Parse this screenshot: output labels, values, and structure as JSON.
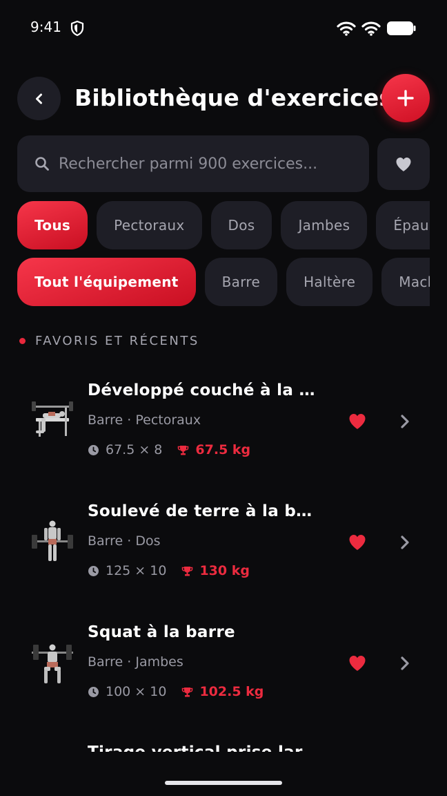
{
  "status_bar": {
    "time": "9:41"
  },
  "header": {
    "title": "Bibliothèque d'exercices"
  },
  "search": {
    "placeholder": "Rechercher parmi 900 exercices..."
  },
  "muscle_filters": [
    {
      "label": "Tous",
      "active": true
    },
    {
      "label": "Pectoraux",
      "active": false
    },
    {
      "label": "Dos",
      "active": false
    },
    {
      "label": "Jambes",
      "active": false
    },
    {
      "label": "Épaules",
      "active": false
    }
  ],
  "equipment_filters": [
    {
      "label": "Tout l'équipement",
      "active": true
    },
    {
      "label": "Barre",
      "active": false
    },
    {
      "label": "Haltère",
      "active": false
    },
    {
      "label": "Machine",
      "active": false
    }
  ],
  "section": {
    "title": "FAVORIS ET RÉCENTS"
  },
  "exercises": [
    {
      "name": "Développé couché à la barre",
      "meta": "Barre · Pectoraux",
      "last": "67.5 × 8",
      "pr": "67.5 kg",
      "favorite": true
    },
    {
      "name": "Soulevé de terre à la barre",
      "meta": "Barre · Dos",
      "last": "125 × 10",
      "pr": "130 kg",
      "favorite": true
    },
    {
      "name": "Squat à la barre",
      "meta": "Barre · Jambes",
      "last": "100 × 10",
      "pr": "102.5 kg",
      "favorite": true
    },
    {
      "name": "Tirage vertical prise large",
      "meta": "",
      "last": "",
      "pr": "",
      "favorite": true
    }
  ],
  "colors": {
    "accent": "#e8283c",
    "surface": "#1e1e26",
    "background": "#0b0b0d",
    "muted_text": "#9a9aa4"
  },
  "icons": {
    "status": [
      "shield-icon",
      "wifi-icon",
      "battery-icon"
    ],
    "header": [
      "chevron-left-icon",
      "plus-icon"
    ],
    "search": [
      "search-icon",
      "heart-icon"
    ],
    "rows": [
      "clock-icon",
      "trophy-icon",
      "heart-icon",
      "chevron-right-icon"
    ]
  }
}
